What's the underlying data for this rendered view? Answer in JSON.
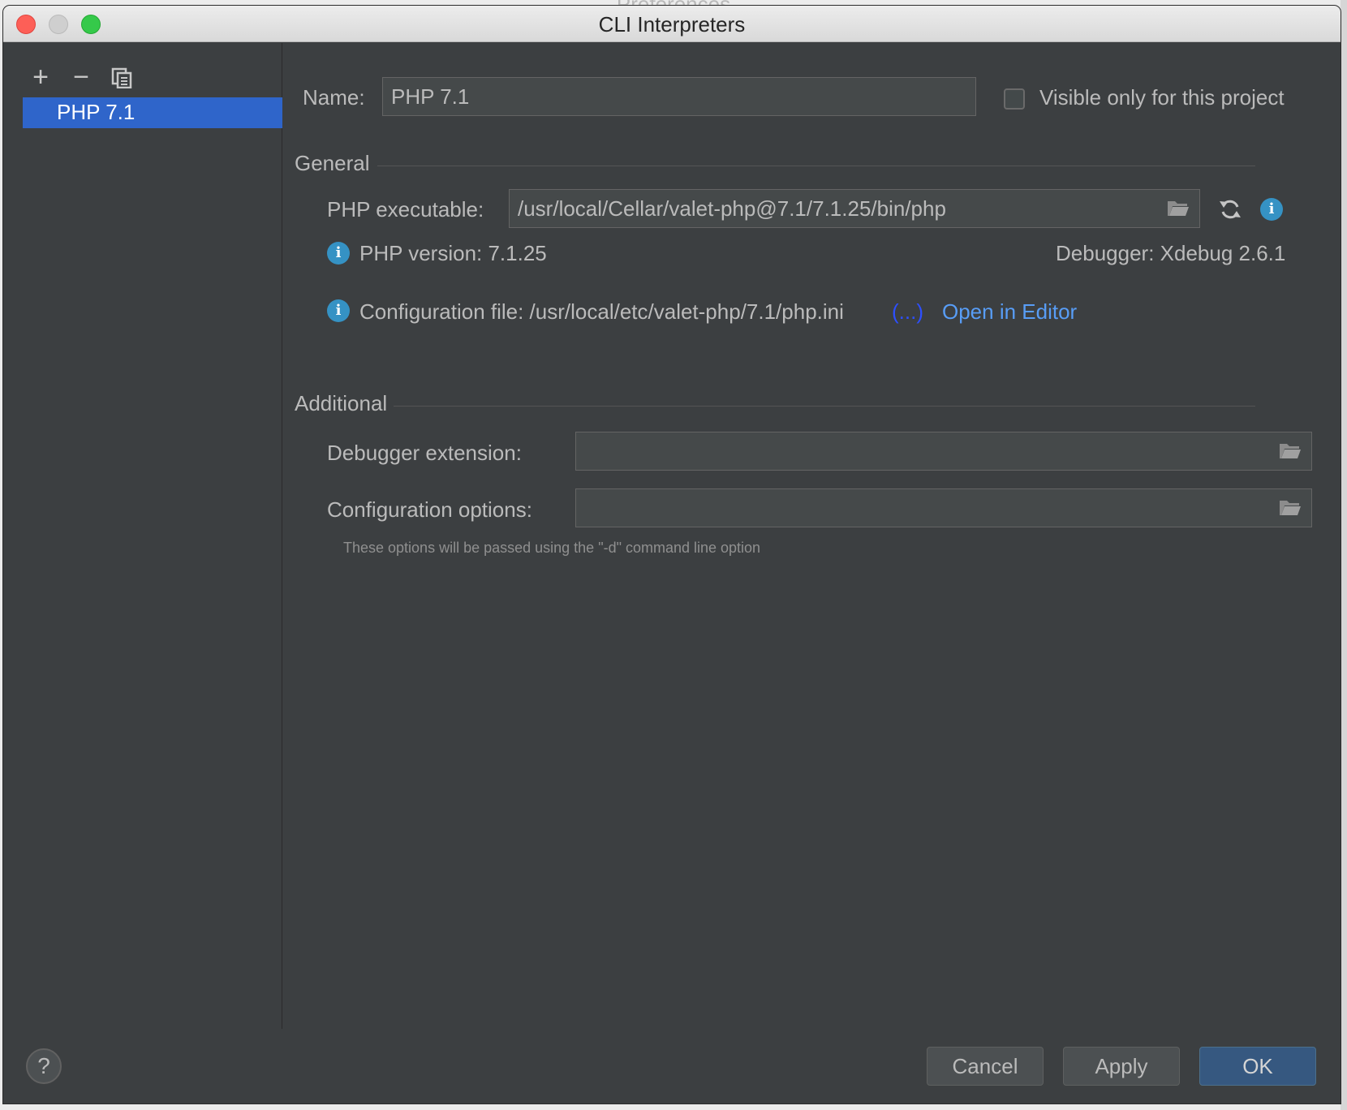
{
  "background_window": {
    "title": "Preferences"
  },
  "dialog": {
    "title": "CLI Interpreters"
  },
  "sidebar": {
    "toolbar": {
      "add": "+",
      "remove": "−"
    },
    "items": [
      {
        "label": "PHP 7.1",
        "selected": true
      }
    ]
  },
  "name_field": {
    "label": "Name:",
    "value": "PHP 7.1"
  },
  "visible_only": {
    "label": "Visible only for this project",
    "checked": false
  },
  "general": {
    "header": "General",
    "php_executable_label": "PHP executable:",
    "php_executable_value": "/usr/local/Cellar/valet-php@7.1/7.1.25/bin/php",
    "php_version": "PHP version: 7.1.25",
    "debugger": "Debugger: Xdebug 2.6.1",
    "config_file_label": "Configuration file: /usr/local/etc/valet-php/7.1/php.ini",
    "config_more": "(...)",
    "open_in_editor": "Open in Editor"
  },
  "additional": {
    "header": "Additional",
    "debugger_extension_label": "Debugger extension:",
    "debugger_extension_value": "",
    "configuration_options_label": "Configuration options:",
    "configuration_options_value": "",
    "hint": "These options will be passed using the \"-d\" command line option"
  },
  "buttons": {
    "help": "?",
    "cancel": "Cancel",
    "apply": "Apply",
    "ok": "OK"
  },
  "colors": {
    "accent_link": "#589df6",
    "selection": "#2f65ca",
    "info": "#3592c4",
    "ellipsis_link": "#2d4fff"
  }
}
